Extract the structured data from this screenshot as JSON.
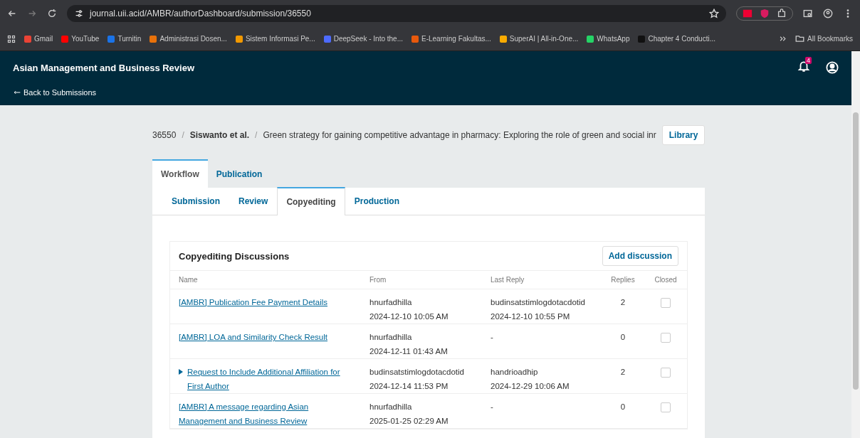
{
  "browser": {
    "url": "journal.uii.acid/AMBR/authorDashboard/submission/36550",
    "bookmarks": [
      {
        "label": "Gmail",
        "color": "#ea4335"
      },
      {
        "label": "YouTube",
        "color": "#ff0000"
      },
      {
        "label": "Turnitin",
        "color": "#1a73e8"
      },
      {
        "label": "Administrasi Dosen...",
        "color": "#e8710a"
      },
      {
        "label": "Sistem Informasi Pe...",
        "color": "#f29900"
      },
      {
        "label": "DeepSeek - Into the...",
        "color": "#4d6bfe"
      },
      {
        "label": "E-Learning Fakultas...",
        "color": "#e8590c"
      },
      {
        "label": "SuperAI | All-in-One...",
        "color": "#f9ab00"
      },
      {
        "label": "WhatsApp",
        "color": "#25d366"
      },
      {
        "label": "Chapter 4 Conducti...",
        "color": "#111111"
      }
    ],
    "all_bookmarks": "All Bookmarks"
  },
  "header": {
    "title": "Asian Management and Business Review",
    "back_link": "Back to Submissions",
    "notifications": "4"
  },
  "breadcrumb": {
    "id": "36550",
    "separators": [
      "/",
      "/"
    ],
    "authors": "Siswanto et al.",
    "title": "Green strategy for gaining competitive advantage in pharmacy: Exploring the role of green and social inr",
    "library_button": "Library"
  },
  "tabs": [
    {
      "label": "Workflow",
      "selected": true
    },
    {
      "label": "Publication",
      "selected": false
    }
  ],
  "stage_tabs": [
    {
      "label": "Submission",
      "selected": false
    },
    {
      "label": "Review",
      "selected": false
    },
    {
      "label": "Copyediting",
      "selected": true
    },
    {
      "label": "Production",
      "selected": false
    }
  ],
  "discussions": {
    "title": "Copyediting Discussions",
    "add_button": "Add discussion",
    "columns": [
      "Name",
      "From",
      "Last Reply",
      "Replies",
      "Closed"
    ],
    "rows": [
      {
        "name": "[AMBR] Publication Fee Payment Details",
        "collapsible": false,
        "from": "hnurfadhilla",
        "from_date": "2024-12-10 10:05 AM",
        "last_reply": "budinsatstimlogdotacdotid",
        "last_reply_date": "2024-12-10 10:55 PM",
        "replies": "2",
        "closed": false
      },
      {
        "name": "[AMBR] LOA and Similarity Check Result",
        "collapsible": false,
        "from": "hnurfadhilla",
        "from_date": "2024-12-11 01:43 AM",
        "last_reply": "-",
        "replies": "0",
        "closed": false
      },
      {
        "name": "Request to Include Additional Affiliation for First Author",
        "collapsible": true,
        "from": "budinsatstimlogdotacdotid",
        "from_date": "2024-12-14 11:53 PM",
        "last_reply": "handrioadhip",
        "last_reply_date": "2024-12-29 10:06 AM",
        "replies": "2",
        "closed": false
      },
      {
        "name": "[AMBR] A message regarding Asian Management and Business Review",
        "collapsible": false,
        "from": "hnurfadhilla",
        "from_date": "2025-01-25 02:29 AM",
        "last_reply": "-",
        "replies": "0",
        "closed": false
      }
    ]
  }
}
